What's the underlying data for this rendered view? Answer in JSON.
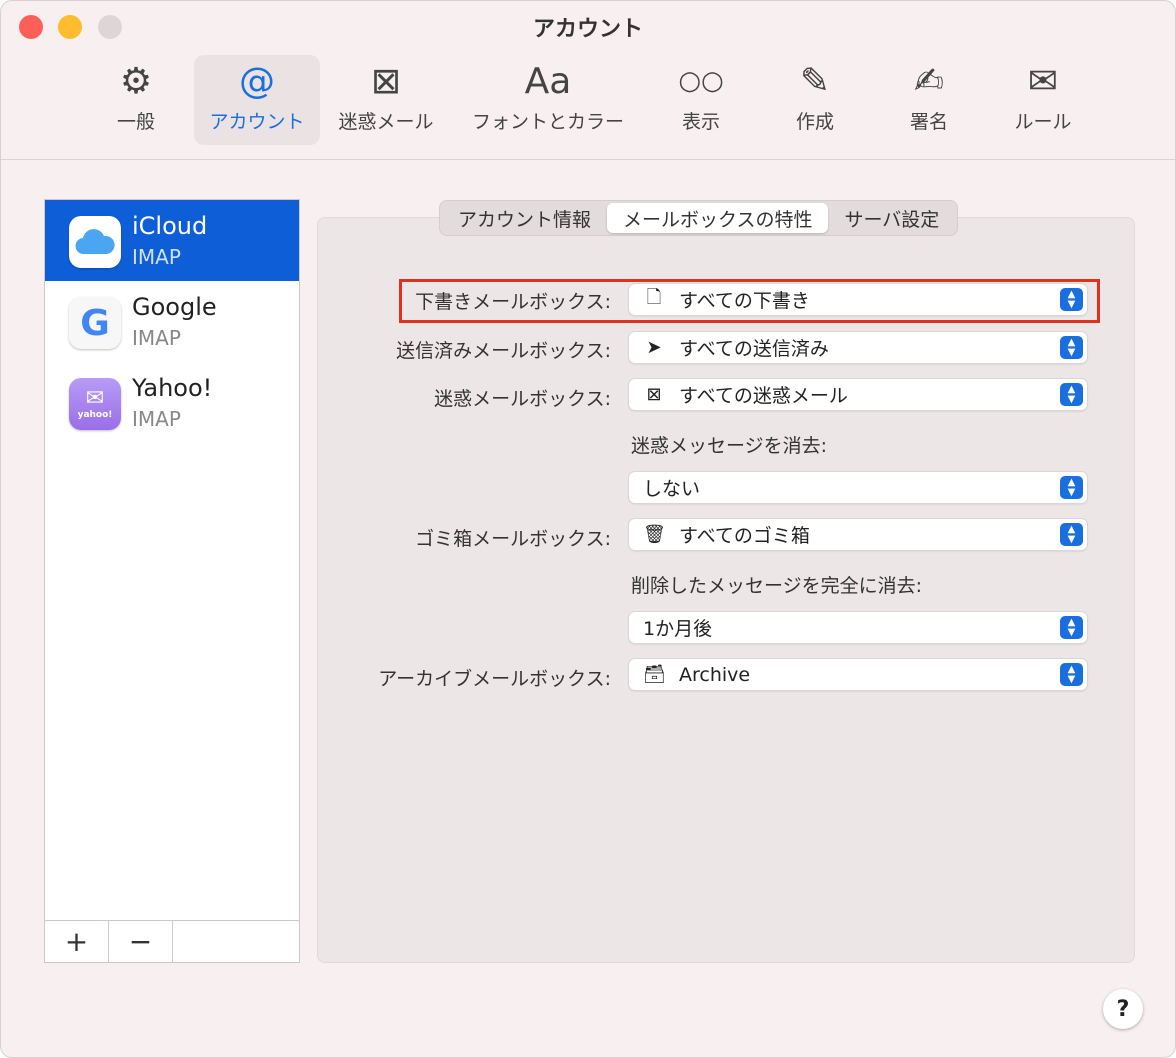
{
  "window": {
    "title": "アカウント"
  },
  "toolbar": [
    {
      "label": "一般",
      "icon": "gear-icon",
      "glyph": "⚙"
    },
    {
      "label": "アカウント",
      "icon": "at-icon",
      "glyph": "@"
    },
    {
      "label": "迷惑メール",
      "icon": "junk-icon",
      "glyph": "⊠"
    },
    {
      "label": "フォントとカラー",
      "icon": "font-icon",
      "glyph": "Aa"
    },
    {
      "label": "表示",
      "icon": "glasses-icon",
      "glyph": "○○"
    },
    {
      "label": "作成",
      "icon": "compose-icon",
      "glyph": "✎"
    },
    {
      "label": "署名",
      "icon": "signature-icon",
      "glyph": "✍"
    },
    {
      "label": "ルール",
      "icon": "rules-icon",
      "glyph": "✉"
    }
  ],
  "accounts": [
    {
      "name": "iCloud",
      "type": "IMAP"
    },
    {
      "name": "Google",
      "type": "IMAP"
    },
    {
      "name": "Yahoo!",
      "type": "IMAP",
      "logo": "yahoo!"
    }
  ],
  "list_buttons": {
    "add": "+",
    "remove": "−"
  },
  "tabs": [
    "アカウント情報",
    "メールボックスの特性",
    "サーバ設定"
  ],
  "fields": {
    "drafts": {
      "label": "下書きメールボックス:",
      "value": "すべての下書き"
    },
    "sent": {
      "label": "送信済みメールボックス:",
      "value": "すべての送信済み"
    },
    "junk": {
      "label": "迷惑メールボックス:",
      "value": "すべての迷惑メール"
    },
    "erase_junk": {
      "label": "迷惑メッセージを消去:",
      "value": "しない"
    },
    "trash": {
      "label": "ゴミ箱メールボックス:",
      "value": "すべてのゴミ箱"
    },
    "erase_deleted": {
      "label": "削除したメッセージを完全に消去:",
      "value": "1か月後"
    },
    "archive": {
      "label": "アーカイブメールボックス:",
      "value": "Archive"
    }
  },
  "help": "?"
}
